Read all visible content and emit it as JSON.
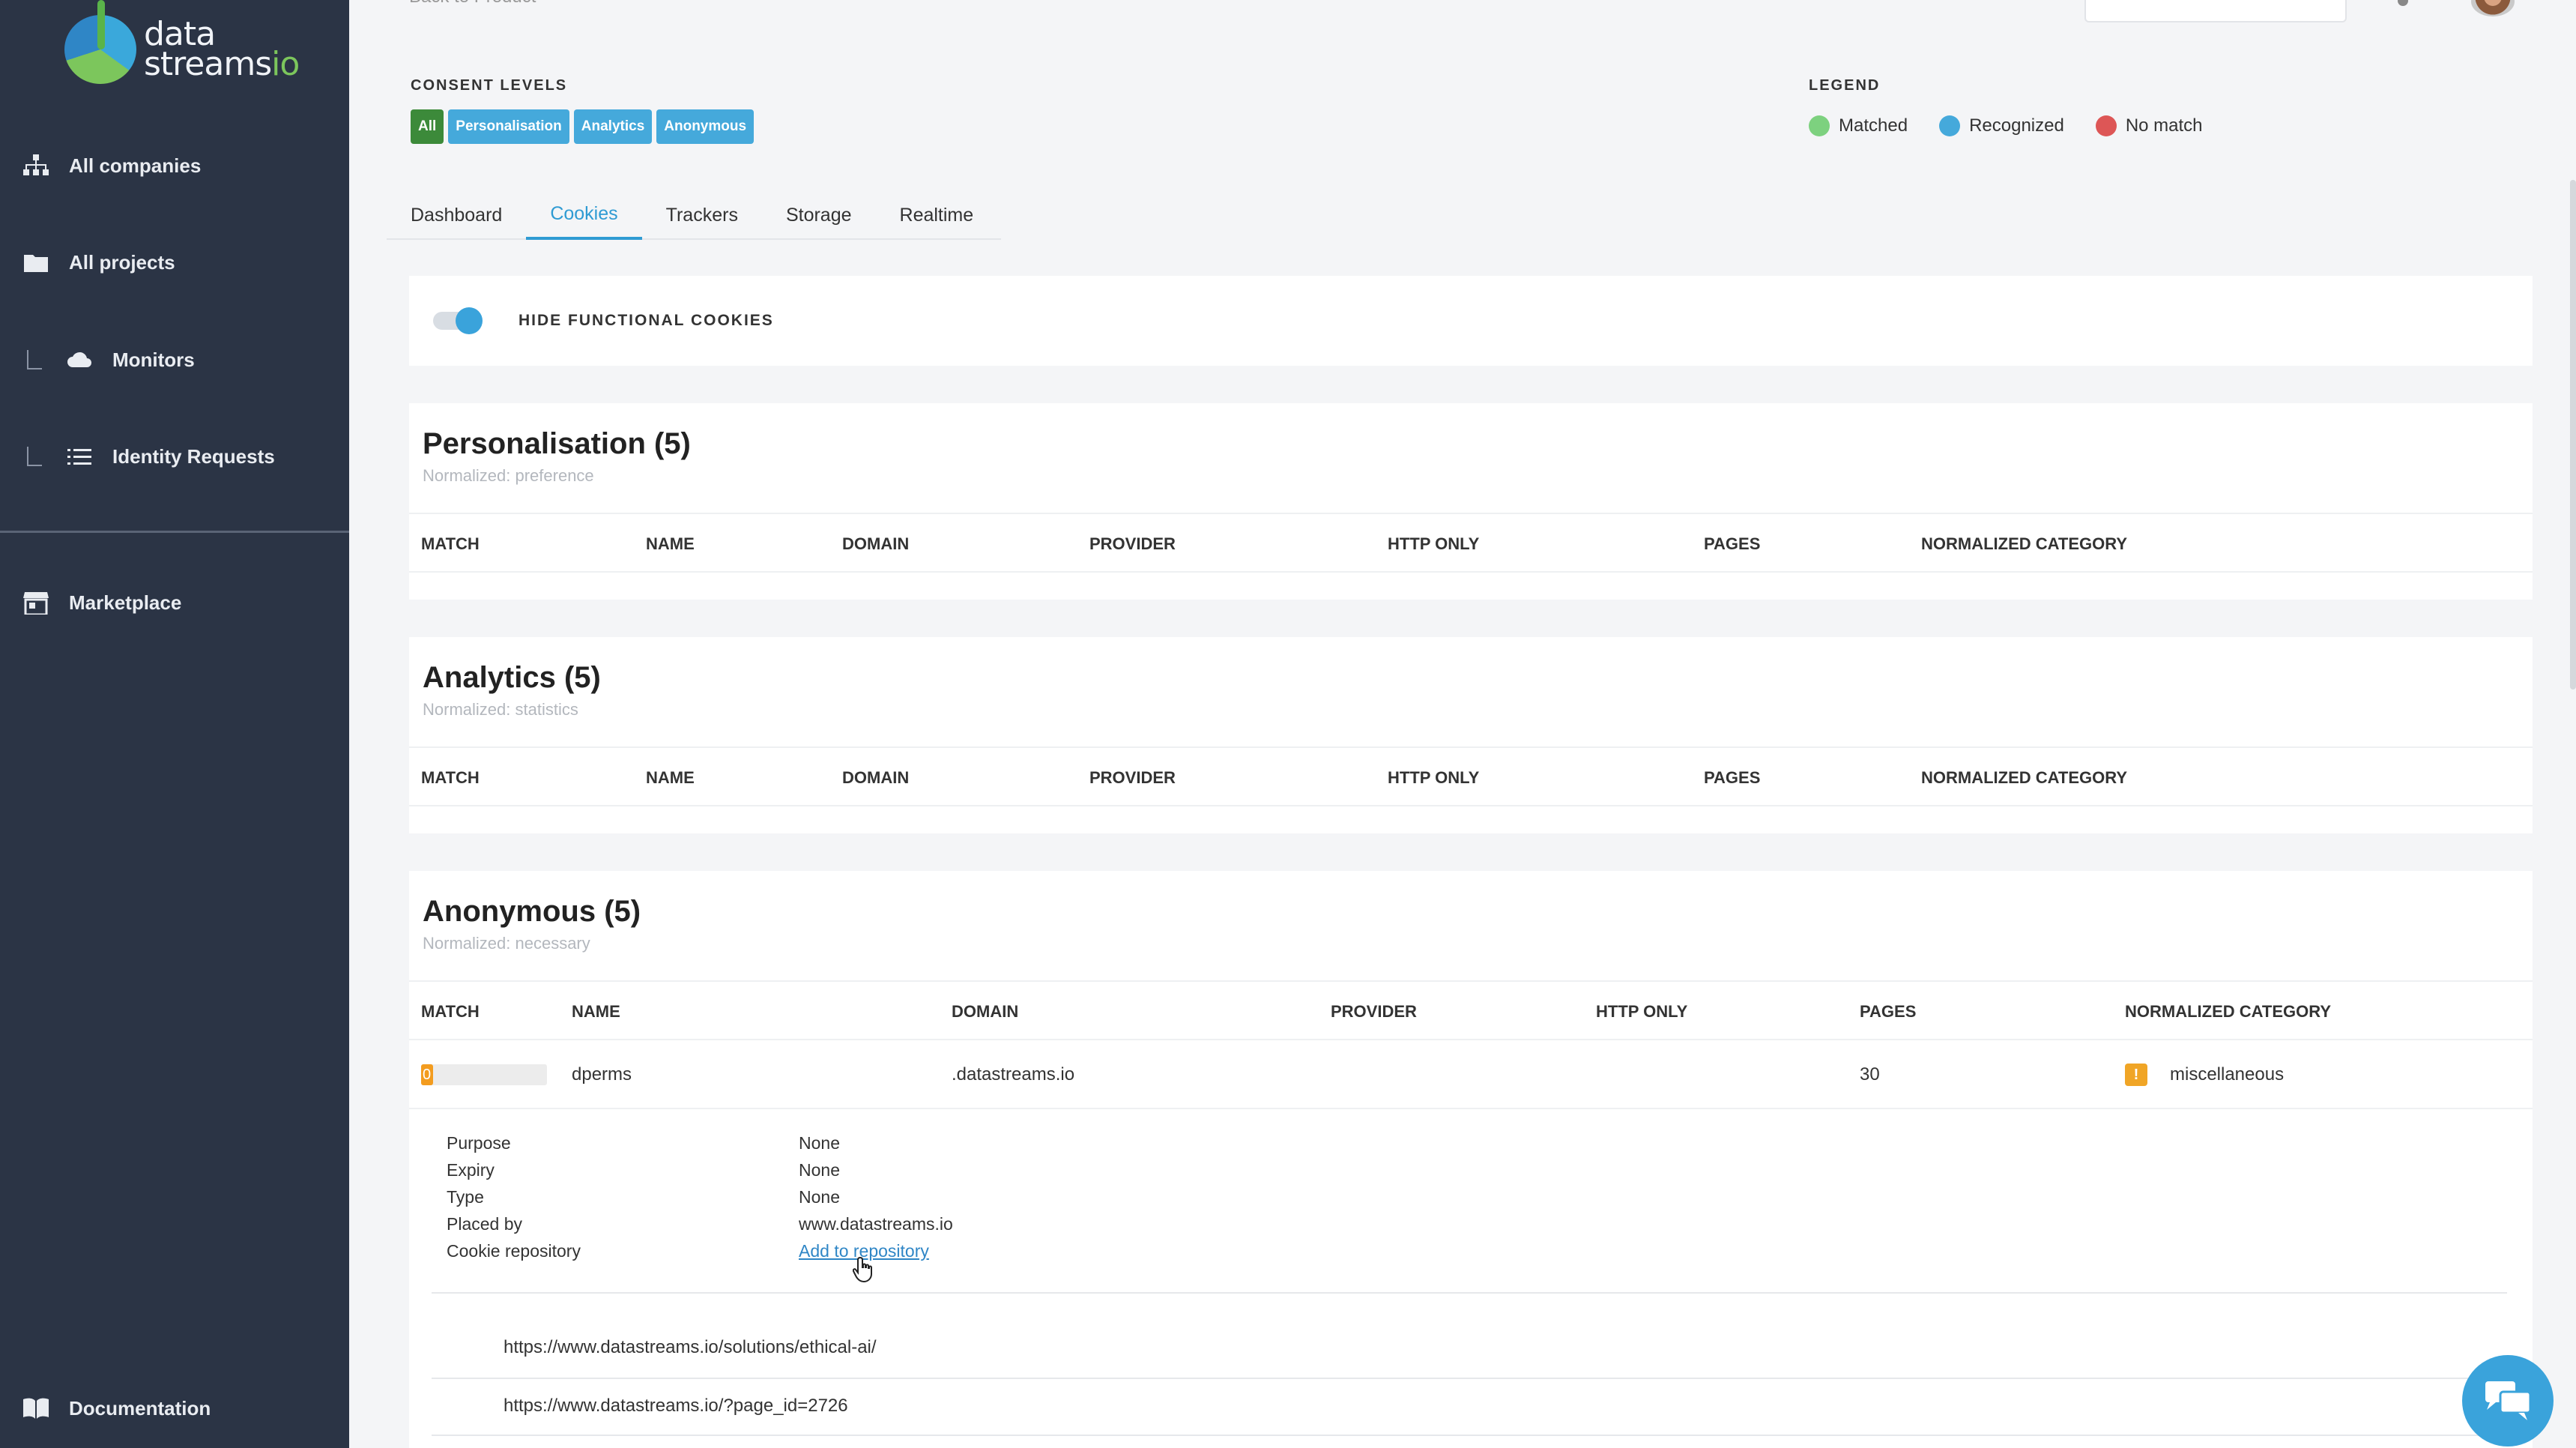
{
  "brand": {
    "logo_text_main": "data",
    "logo_text_second": "streams",
    "logo_text_io": "io"
  },
  "sidebar": {
    "items": [
      {
        "label": "All companies",
        "icon": "sitemap-icon"
      },
      {
        "label": "All projects",
        "icon": "folder-icon"
      },
      {
        "label": "Monitors",
        "icon": "cloud-icon"
      },
      {
        "label": "Identity Requests",
        "icon": "list-icon"
      },
      {
        "label": "Marketplace",
        "icon": "store-icon"
      },
      {
        "label": "Documentation",
        "icon": "book-icon"
      }
    ]
  },
  "header": {
    "back_link": "Back to Product"
  },
  "consent": {
    "title": "CONSENT LEVELS",
    "levels": [
      "All",
      "Personalisation",
      "Analytics",
      "Anonymous"
    ]
  },
  "legend": {
    "title": "LEGEND",
    "items": [
      {
        "label": "Matched",
        "color": "#7dd17f"
      },
      {
        "label": "Recognized",
        "color": "#45a9db"
      },
      {
        "label": "No match",
        "color": "#dd5656"
      }
    ]
  },
  "tabs": [
    "Dashboard",
    "Cookies",
    "Trackers",
    "Storage",
    "Realtime"
  ],
  "active_tab": "Cookies",
  "filter": {
    "label": "HIDE FUNCTIONAL COOKIES",
    "enabled": true
  },
  "columns": [
    "MATCH",
    "NAME",
    "DOMAIN",
    "PROVIDER",
    "HTTP ONLY",
    "PAGES",
    "NORMALIZED CATEGORY"
  ],
  "categories": [
    {
      "title": "Personalisation (5)",
      "normalized": "Normalized: preference"
    },
    {
      "title": "Analytics (5)",
      "normalized": "Normalized: statistics"
    },
    {
      "title": "Anonymous (5)",
      "normalized": "Normalized: necessary",
      "rows": [
        {
          "match": "0",
          "name": "dperms",
          "domain": ".datastreams.io",
          "provider": "",
          "http_only": "",
          "pages": "30",
          "category": "miscellaneous",
          "category_badge": "!"
        }
      ],
      "details": {
        "purpose_label": "Purpose",
        "purpose": "None",
        "expiry_label": "Expiry",
        "expiry": "None",
        "type_label": "Type",
        "type": "None",
        "placed_by_label": "Placed by",
        "placed_by": "www.datastreams.io",
        "repo_label": "Cookie repository",
        "repo_action": "Add to repository"
      },
      "pages_list": [
        "https://www.datastreams.io/solutions/ethical-ai/",
        "https://www.datastreams.io/?page_id=2726"
      ]
    }
  ]
}
